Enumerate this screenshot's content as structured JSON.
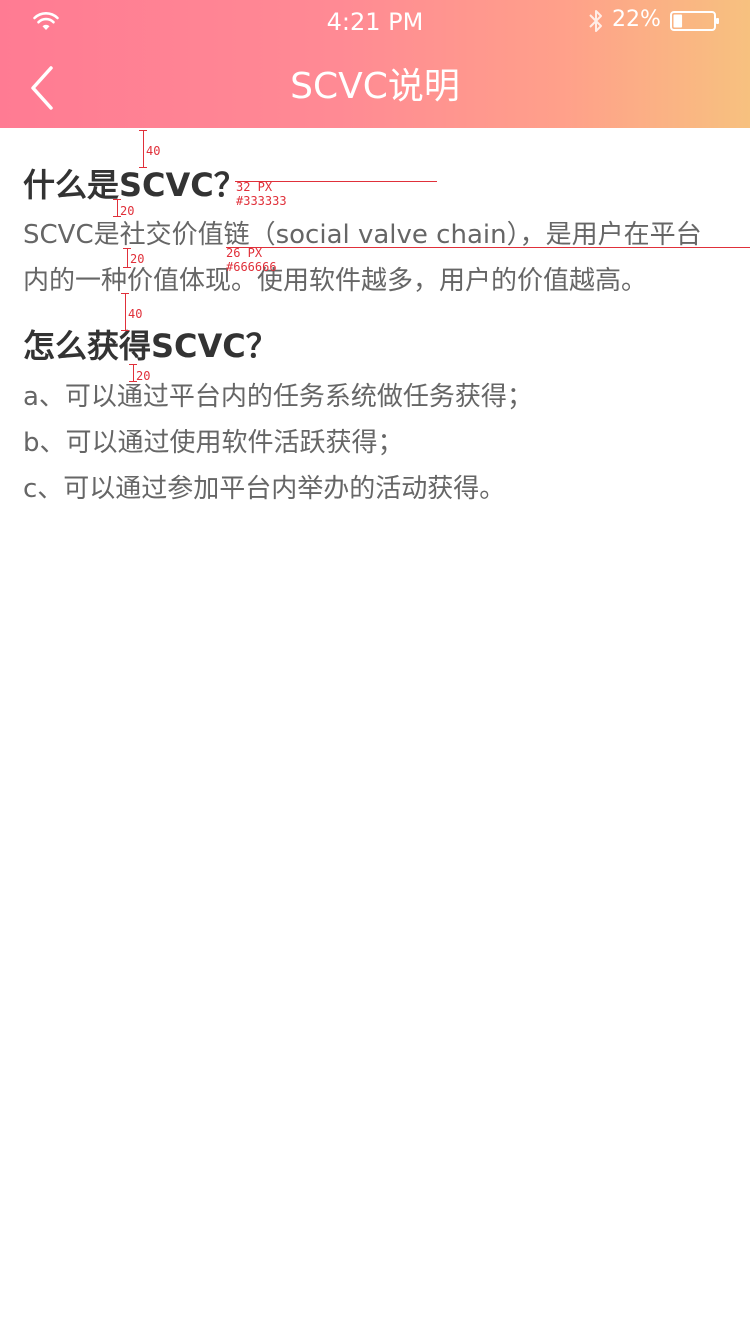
{
  "status_bar": {
    "time": "4:21 PM",
    "battery_percent": "22%",
    "battery_level": 0.22,
    "wifi_icon": "wifi-icon",
    "bluetooth_icon": "bluetooth-icon"
  },
  "nav": {
    "title": "SCVC说明",
    "back_icon": "chevron-left-icon"
  },
  "content": {
    "section1": {
      "heading": "什么是SCVC？",
      "body": "SCVC是社交价值链（social  valve  chain），是用户在平台内的一种价值体现。使用软件越多，用户的价值越高。"
    },
    "section2": {
      "heading": "怎么获得SCVC？",
      "items": [
        "a、可以通过平台内的任务系统做任务获得；",
        "b、可以通过使用软件活跃获得；",
        "c、可以通过参加平台内举办的活动获得。"
      ]
    }
  },
  "annotations": {
    "gap_top": "40",
    "heading_spec_size": "32 PX",
    "heading_spec_color": "#333333",
    "gap_heading_body": "20",
    "body_spec_size": "26 PX",
    "body_spec_color": "#666666",
    "gap_body_line": "20",
    "gap_section": "40",
    "gap_heading_list": "20"
  },
  "colors": {
    "header_gradient_start": "#ff7b93",
    "header_gradient_end": "#f7c17f",
    "heading_text": "#333333",
    "body_text": "#666666",
    "annotation": "#e0303a"
  }
}
